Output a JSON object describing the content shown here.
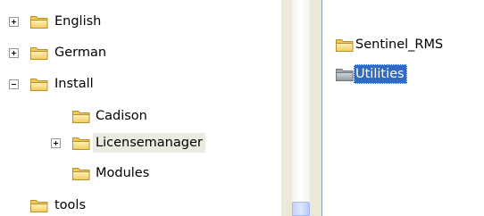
{
  "tree": {
    "items": [
      {
        "label": "English",
        "expander": "plus"
      },
      {
        "label": "German",
        "expander": "plus"
      },
      {
        "label": "Install",
        "expander": "minus"
      },
      {
        "label": "Cadison",
        "expander": "none"
      },
      {
        "label": "Licensemanager",
        "expander": "plus",
        "selected": "inactive"
      },
      {
        "label": "Modules",
        "expander": "none"
      },
      {
        "label": "tools",
        "expander": "none"
      }
    ]
  },
  "list": {
    "items": [
      {
        "label": "Sentinel_RMS",
        "icon": "folder-icon"
      },
      {
        "label": "Utilities",
        "icon": "folder-icon",
        "selected": "active"
      }
    ]
  },
  "colors": {
    "folder_fill": "#f5d77a",
    "folder_edge": "#c7a23b",
    "selection_active": "#316ac5",
    "selection_inactive": "#ecebe1",
    "utilities_folder": "#9aa3ab"
  }
}
